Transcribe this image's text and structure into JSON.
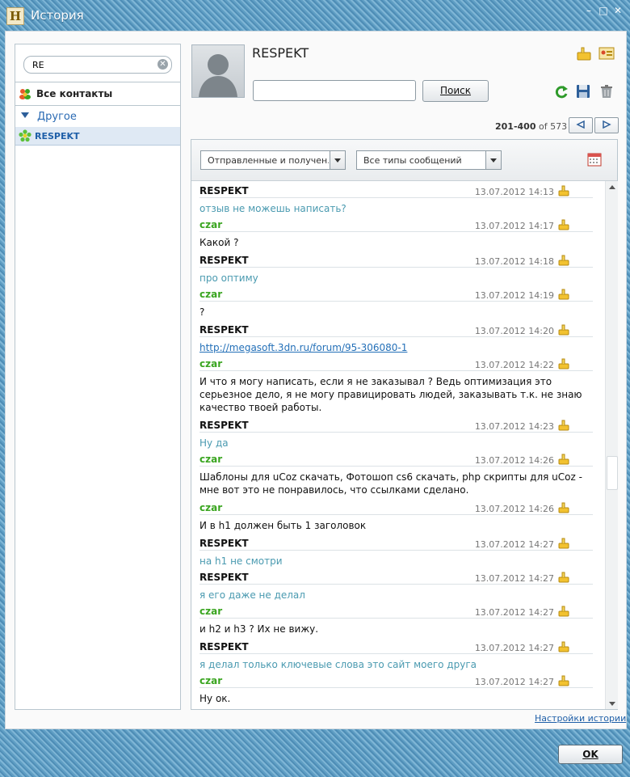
{
  "window": {
    "title": "История",
    "app_icon": "H"
  },
  "sidebar": {
    "search_value": "RE",
    "all_contacts_label": "Все контакты",
    "group_label": "Другое",
    "contact_label": "RESPEKT"
  },
  "header": {
    "contact_name": "RESPEKT",
    "search_value": "",
    "search_button": "Поиск"
  },
  "pager": {
    "range": "201-400",
    "of_text": "of 573"
  },
  "filters": {
    "direction": "Отправленные и получен…",
    "type": "Все типы сообщений"
  },
  "messages": [
    {
      "sender": "RESPEKT",
      "time": "13.07.2012 14:13",
      "text": "отзыв не можешь написать?"
    },
    {
      "sender": "czar",
      "time": "13.07.2012 14:17",
      "text": "Какой ?"
    },
    {
      "sender": "RESPEKT",
      "time": "13.07.2012 14:18",
      "text": "про оптиму"
    },
    {
      "sender": "czar",
      "time": "13.07.2012 14:19",
      "text": "?"
    },
    {
      "sender": "RESPEKT",
      "time": "13.07.2012 14:20",
      "text": "http://megasoft.3dn.ru/forum/95-306080-1"
    },
    {
      "sender": "czar",
      "time": "13.07.2012 14:22",
      "text": "И что я могу написать, если я не заказывал ? Ведь оптимизация это серьезное дело, я не могу правицировать людей, заказывать т.к. не знаю качество твоей работы."
    },
    {
      "sender": "RESPEKT",
      "time": "13.07.2012 14:23",
      "text": "Ну да"
    },
    {
      "sender": "czar",
      "time": "13.07.2012 14:26",
      "text": "Шаблоны для uCoz скачать, Фотошоп cs6 скачать, php скрипты для uCoz - мне вот это не понравилось, что ссылками сделано."
    },
    {
      "sender": "czar",
      "time": "13.07.2012 14:26",
      "text": "И в h1 должен быть 1 заголовок"
    },
    {
      "sender": "RESPEKT",
      "time": "13.07.2012 14:27",
      "text": "на h1 не смотри"
    },
    {
      "sender": "RESPEKT",
      "time": "13.07.2012 14:27",
      "text": "я его даже не делал"
    },
    {
      "sender": "czar",
      "time": "13.07.2012 14:27",
      "text": "и h2 и h3 ? Их не вижу."
    },
    {
      "sender": "RESPEKT",
      "time": "13.07.2012 14:27",
      "text": "я делал только ключевые слова это сайт моего друга"
    },
    {
      "sender": "czar",
      "time": "13.07.2012 14:27",
      "text": "Ну ок."
    }
  ],
  "footer": {
    "settings_link": "Настройки истории",
    "ok_button": "OK"
  },
  "icons": {
    "clear": "clear-search-icon",
    "contacts": "contacts-icon",
    "flower": "icq-flower-icon",
    "thumb": "thumb-up-icon",
    "refresh": "refresh-icon",
    "save": "save-icon",
    "trash": "trash-icon",
    "calendar": "calendar-icon"
  },
  "colors": {
    "outgoing_text": "#4a9ab0",
    "incoming_sender": "#3aa520",
    "link": "#2470b8",
    "accent_blue": "#1f5fa8"
  }
}
